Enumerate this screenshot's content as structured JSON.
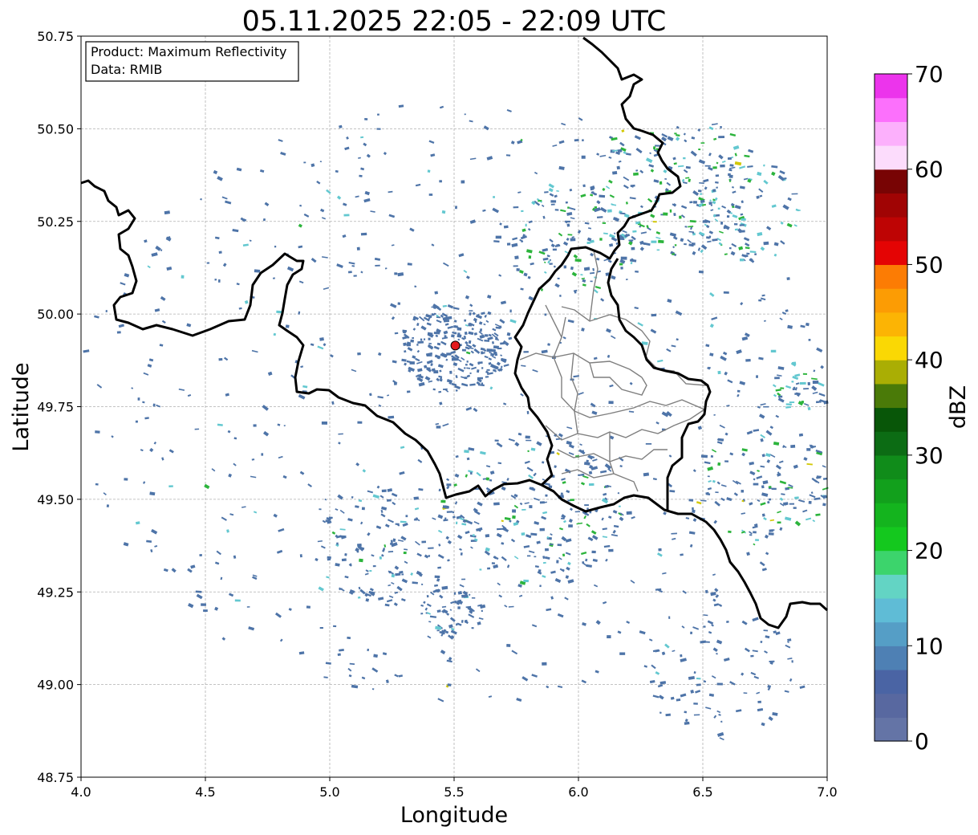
{
  "title": "05.11.2025 22:05 - 22:09 UTC",
  "info_box": {
    "product": "Product: Maximum Reflectivity",
    "data": "Data: RMIB"
  },
  "axes": {
    "xlabel": "Longitude",
    "ylabel": "Latitude",
    "xlim": [
      4.0,
      7.0
    ],
    "ylim": [
      48.75,
      50.75
    ],
    "xticks": [
      "4.0",
      "4.5",
      "5.0",
      "5.5",
      "6.0",
      "6.5",
      "7.0"
    ],
    "yticks": [
      "48.75",
      "49.00",
      "49.25",
      "49.50",
      "49.75",
      "50.00",
      "50.25",
      "50.50",
      "50.75"
    ],
    "grid": true
  },
  "radar_site": {
    "lon": 5.505,
    "lat": 49.915,
    "color": "#e31a1c"
  },
  "colorbar": {
    "label": "dBZ",
    "ticks": [
      "0",
      "10",
      "20",
      "30",
      "40",
      "50",
      "60",
      "70"
    ],
    "range": [
      0,
      70
    ],
    "colors": [
      "#6474a6",
      "#5868a0",
      "#4a64a4",
      "#4e80b4",
      "#559ec6",
      "#5fbcd6",
      "#63d4c4",
      "#3cd46c",
      "#14c81e",
      "#14b41e",
      "#12a01c",
      "#108c1a",
      "#0c6c14",
      "#085608",
      "#4a7a08",
      "#aaae04",
      "#fad804",
      "#fcb404",
      "#fc9c04",
      "#fc7c04",
      "#e40404",
      "#be0404",
      "#a00404",
      "#780404",
      "#fcdcfc",
      "#fcb0fc",
      "#fc70fc",
      "#ec34ec"
    ]
  },
  "borders_color": "#000000",
  "provinces_color": "#7f7f7f",
  "echo_colors": {
    "weak": "#4e74a8",
    "light": "#63c8d0",
    "moderate": "#2cb43c",
    "strong": "#d2c804"
  }
}
